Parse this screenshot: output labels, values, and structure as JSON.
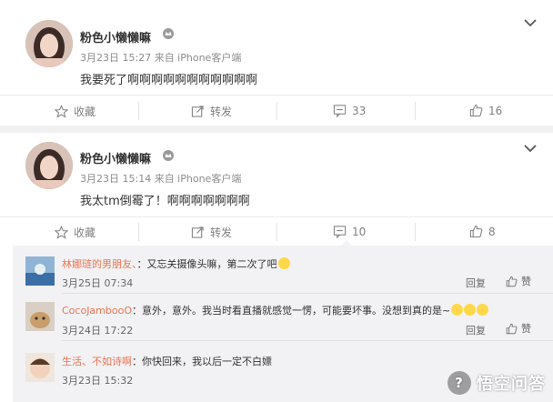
{
  "posts": [
    {
      "username": "粉色小懒懒嘛",
      "verify_icon": "crown-icon",
      "meta": "3月23日 15:27 来自 iPhone客户端",
      "text": "我要死了啊啊啊啊啊啊啊啊啊啊啊",
      "actions": {
        "favorite": "收藏",
        "repost": "转发",
        "comment_count": "33",
        "like_count": "16"
      }
    },
    {
      "username": "粉色小懒懒嘛",
      "verify_icon": "crown-icon",
      "meta": "3月23日 15:14 来自 iPhone客户端",
      "text": "我太tm倒霉了！啊啊啊啊啊啊啊",
      "actions": {
        "favorite": "收藏",
        "repost": "转发",
        "comment_count": "10",
        "like_count": "8"
      }
    }
  ],
  "comments": [
    {
      "user": "林娜琏的男朋友、",
      "text": "：又忘关摄像头嘛，第二次了吧",
      "emoji": "smile-emoji",
      "time": "3月25日 07:34",
      "reply": "回复",
      "like": "赞"
    },
    {
      "user": "CocoJambooO",
      "text": "：意外，意外。我当时看直播就感觉一愣，可能要坏事。没想到真的是~",
      "emoji": "sad-emoji",
      "time": "3月24日 17:22",
      "reply": "回复",
      "like": "赞"
    },
    {
      "user": "生活、不如诗啊",
      "text": "：你快回来，我以后一定不白嫖",
      "time": "3月23日 15:32"
    }
  ],
  "watermark": "悟空问答",
  "colors": {
    "accent_username": "#eb7350",
    "comment_bg": "#f2f2f5"
  }
}
